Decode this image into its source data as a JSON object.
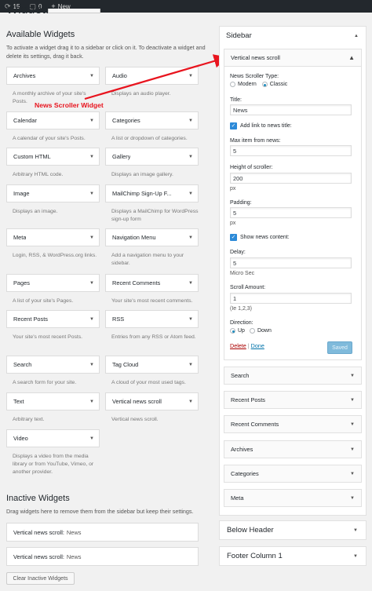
{
  "adminbar": {
    "comments": "15",
    "pending": "0",
    "new_label": "New"
  },
  "page_title": "Widgets",
  "available": {
    "heading": "Available Widgets",
    "description": "To activate a widget drag it to a sidebar or click on it. To deactivate a widget and delete its settings, drag it back."
  },
  "widgets": [
    {
      "title": "Archives",
      "desc": "A monthly archive of your site's Posts."
    },
    {
      "title": "Audio",
      "desc": "Displays an audio player."
    },
    {
      "title": "Calendar",
      "desc": "A calendar of your site's Posts."
    },
    {
      "title": "Categories",
      "desc": "A list or dropdown of categories."
    },
    {
      "title": "Custom HTML",
      "desc": "Arbitrary HTML code."
    },
    {
      "title": "Gallery",
      "desc": "Displays an image gallery."
    },
    {
      "title": "Image",
      "desc": "Displays an image."
    },
    {
      "title": "MailChimp Sign-Up F...",
      "desc": "Displays a MailChimp for WordPress sign-up form"
    },
    {
      "title": "Meta",
      "desc": "Login, RSS, & WordPress.org links."
    },
    {
      "title": "Navigation Menu",
      "desc": "Add a navigation menu to your sidebar."
    },
    {
      "title": "Pages",
      "desc": "A list of your site's Pages."
    },
    {
      "title": "Recent Comments",
      "desc": "Your site's most recent comments."
    },
    {
      "title": "Recent Posts",
      "desc": "Your site's most recent Posts."
    },
    {
      "title": "RSS",
      "desc": "Entries from any RSS or Atom feed."
    },
    {
      "title": "Search",
      "desc": "A search form for your site."
    },
    {
      "title": "Tag Cloud",
      "desc": "A cloud of your most used tags."
    },
    {
      "title": "Text",
      "desc": "Arbitrary text."
    },
    {
      "title": "Vertical news scroll",
      "desc": "Vertical news scroll."
    },
    {
      "title": "Video",
      "desc": "Displays a video from the media library or from YouTube, Vimeo, or another provider."
    }
  ],
  "annotation": "News Scroller Widget",
  "annotation_color": "#e8141e",
  "inactive": {
    "heading": "Inactive Widgets",
    "description": "Drag widgets here to remove them from the sidebar but keep their settings.",
    "items": [
      {
        "title": "Vertical news scroll:",
        "sub": "News"
      },
      {
        "title": "Vertical news scroll:",
        "sub": "News"
      }
    ],
    "clear_button": "Clear Inactive Widgets"
  },
  "sidebar": {
    "title": "Sidebar",
    "open_widget": {
      "title": "Vertical news scroll",
      "type_label": "News Scroller Type:",
      "type_options": [
        "Modern",
        "Classic"
      ],
      "type_selected": "Classic",
      "title_label": "Title:",
      "title_value": "News",
      "add_link_label": "Add link to news title:",
      "max_items_label": "Max item from news:",
      "max_items_value": "5",
      "height_label": "Height of scroller:",
      "height_value": "200",
      "height_unit": "px",
      "padding_label": "Padding:",
      "padding_value": "5",
      "padding_unit": "px",
      "show_content_label": "Show news content:",
      "delay_label": "Delay:",
      "delay_value": "5",
      "delay_unit": "Micro Sec",
      "scroll_amount_label": "Scroll Amount:",
      "scroll_amount_value": "1",
      "scroll_amount_hint": "(Ie 1,2,3)",
      "direction_label": "Direction:",
      "direction_options": [
        "Up",
        "Down"
      ],
      "direction_selected": "Up",
      "delete_label": "Delete",
      "separator": "|",
      "done_label": "Done",
      "save_label": "Saved"
    },
    "widgets": [
      "Search",
      "Recent Posts",
      "Recent Comments",
      "Archives",
      "Categories",
      "Meta"
    ]
  },
  "other_areas": [
    "Below Header",
    "Footer Column 1"
  ],
  "colors": {
    "accent": "#0073aa",
    "checkbox": "#2c8ad8",
    "delete": "#a00",
    "adminbar": "#23282d"
  }
}
